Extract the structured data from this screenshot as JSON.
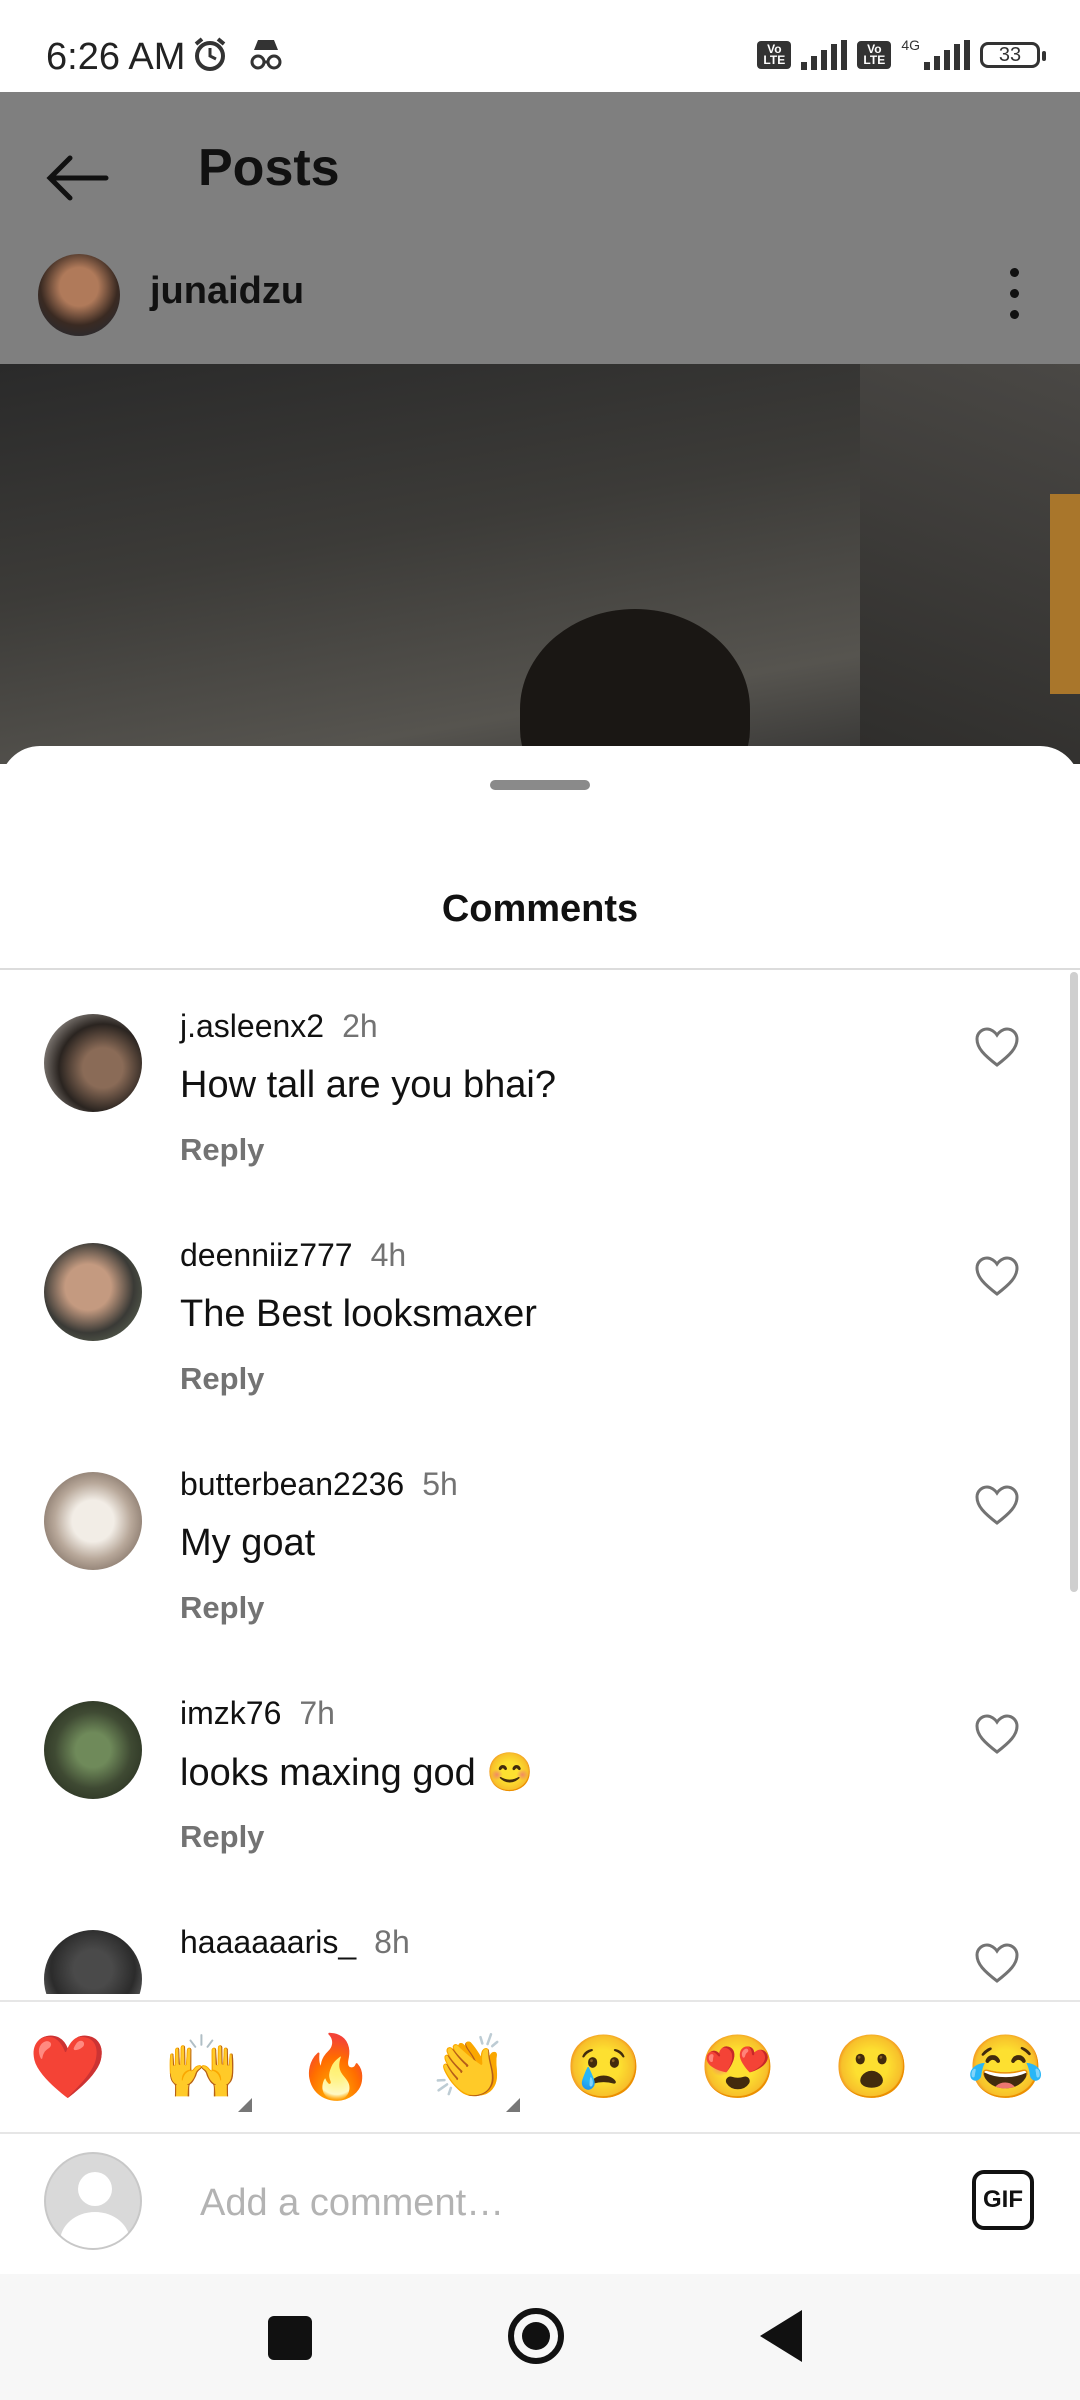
{
  "status_bar": {
    "time": "6:26 AM",
    "icons": [
      "alarm-icon",
      "incognito-icon"
    ],
    "network": "4G",
    "battery": "33"
  },
  "header": {
    "title": "Posts",
    "back_icon": "back-arrow-icon",
    "username": "junaidzu",
    "more_icon": "more-vertical-icon"
  },
  "comments_sheet": {
    "title": "Comments",
    "reply_label": "Reply",
    "comments": [
      {
        "username": "j.asleenx2",
        "time": "2h",
        "text": "How tall are you bhai?",
        "reply": "Reply"
      },
      {
        "username": "deenniiz777",
        "time": "4h",
        "text": "The Best looksmaxer",
        "reply": "Reply"
      },
      {
        "username": "butterbean2236",
        "time": "5h",
        "text": "My goat",
        "reply": "Reply"
      },
      {
        "username": "imzk76",
        "time": "7h",
        "text": "looks maxing god 😊",
        "reply": "Reply"
      },
      {
        "username": "haaaaaaris_",
        "time": "8h",
        "text": "",
        "reply": ""
      }
    ]
  },
  "emoji_bar": [
    "❤️",
    "🙌",
    "🔥",
    "👏",
    "😢",
    "😍",
    "😮",
    "😂"
  ],
  "input": {
    "placeholder": "Add a comment…",
    "gif_label": "GIF"
  },
  "nav": {
    "icons": [
      "recents-square-icon",
      "home-circle-icon",
      "back-triangle-icon"
    ]
  }
}
